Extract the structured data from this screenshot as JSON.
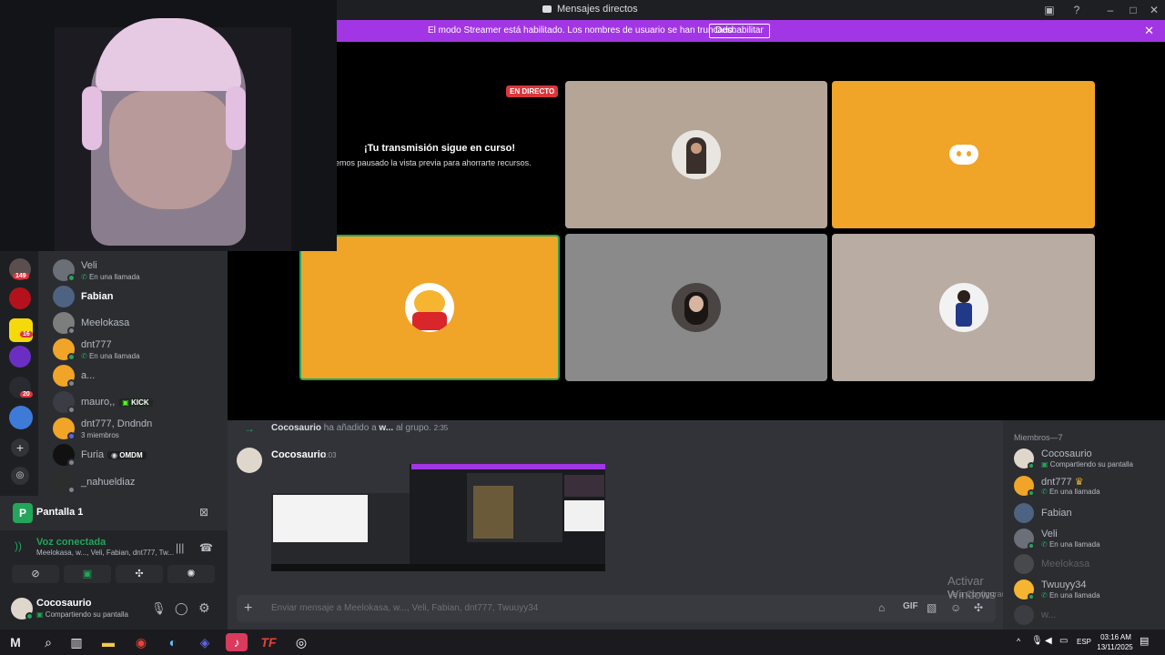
{
  "window": {
    "title": "Mensajes directos"
  },
  "banner": {
    "text": "El modo Streamer está habilitado. Los nombres de usuario se han truncado.",
    "button": "Deshabilitar"
  },
  "stage": {
    "live_badge": "EN DIRECTO",
    "notice_title": "¡Tu transmisión sigue en curso!",
    "notice_body": "emos pausado la vista previa para ahorrarte recursos."
  },
  "rail": {
    "badges": [
      "149",
      "16",
      "20"
    ]
  },
  "dm_list": [
    {
      "name": "Veli",
      "sub": "En una llamada"
    },
    {
      "name": "Fabian",
      "sub": ""
    },
    {
      "name": "Meelokasa",
      "sub": ""
    },
    {
      "name": "dnt777",
      "sub": "En una llamada"
    },
    {
      "name": "a...",
      "sub": ""
    },
    {
      "name": "mauro,,",
      "sub": "",
      "tag": "KICK"
    },
    {
      "name": "dnt777, Dndndn",
      "sub": "3 miembros"
    },
    {
      "name": "Furia",
      "sub": "",
      "tag": "OMDM"
    },
    {
      "name": "_nahueldiaz",
      "sub": ""
    }
  ],
  "voice": {
    "screen_label": "Pantalla 1",
    "status": "Voz conectada",
    "participants": "Meelokasa, w..., Veli, Fabian, dnt777, Tw..."
  },
  "user": {
    "name": "Cocosaurio",
    "status": "Compartiendo su pantalla"
  },
  "chat": {
    "system": {
      "actor": "Cocosaurio",
      "action": "ha añadido a",
      "target": "w...",
      "suffix": "al grupo.",
      "time": "2:35"
    },
    "message": {
      "author": "Cocosaurio",
      "time": "3:03"
    },
    "input_placeholder": "Enviar mensaje a Meelokasa, w..., Veli, Fabian, dnt777, Twuuyy34"
  },
  "members": {
    "header": "Miembros—7",
    "list": [
      {
        "name": "Cocosaurio",
        "sub": "Compartiendo su pantalla"
      },
      {
        "name": "dnt777",
        "sub": "En una llamada"
      },
      {
        "name": "Fabian",
        "sub": ""
      },
      {
        "name": "Veli",
        "sub": "En una llamada"
      },
      {
        "name": "Meelokasa",
        "sub": ""
      },
      {
        "name": "Twuuyy34",
        "sub": "En una llamada"
      },
      {
        "name": "w...",
        "sub": ""
      }
    ]
  },
  "watermark": {
    "title": "Activar Windows",
    "body": "Ve a Configuración para activar Windows."
  },
  "taskbar": {
    "lang": "ESP",
    "time": "03:16 AM",
    "date": "13/11/2025"
  },
  "colors": {
    "accent_purple": "#a236e4",
    "live_red": "#da373c",
    "status_green": "#23a55a",
    "tile_orange": "#f0a428",
    "tile_beige": "#b4a597",
    "tile_gray": "#8a8a8a"
  }
}
